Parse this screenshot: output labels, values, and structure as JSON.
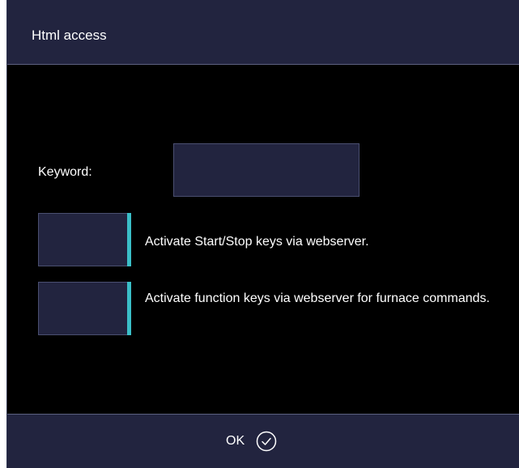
{
  "dialog": {
    "title": "Html access",
    "keyword_label": "Keyword:",
    "keyword_value": "",
    "options": [
      {
        "label": "Activate Start/Stop keys via webserver.",
        "checked": false
      },
      {
        "label": "Activate function keys via webserver for furnace commands.",
        "checked": false
      }
    ],
    "ok_label": "OK",
    "ok_icon": "check-circle-icon"
  },
  "colors": {
    "panel": "#22243f",
    "background": "#000000",
    "accent": "#3bbfc8",
    "text": "#ffffff"
  }
}
